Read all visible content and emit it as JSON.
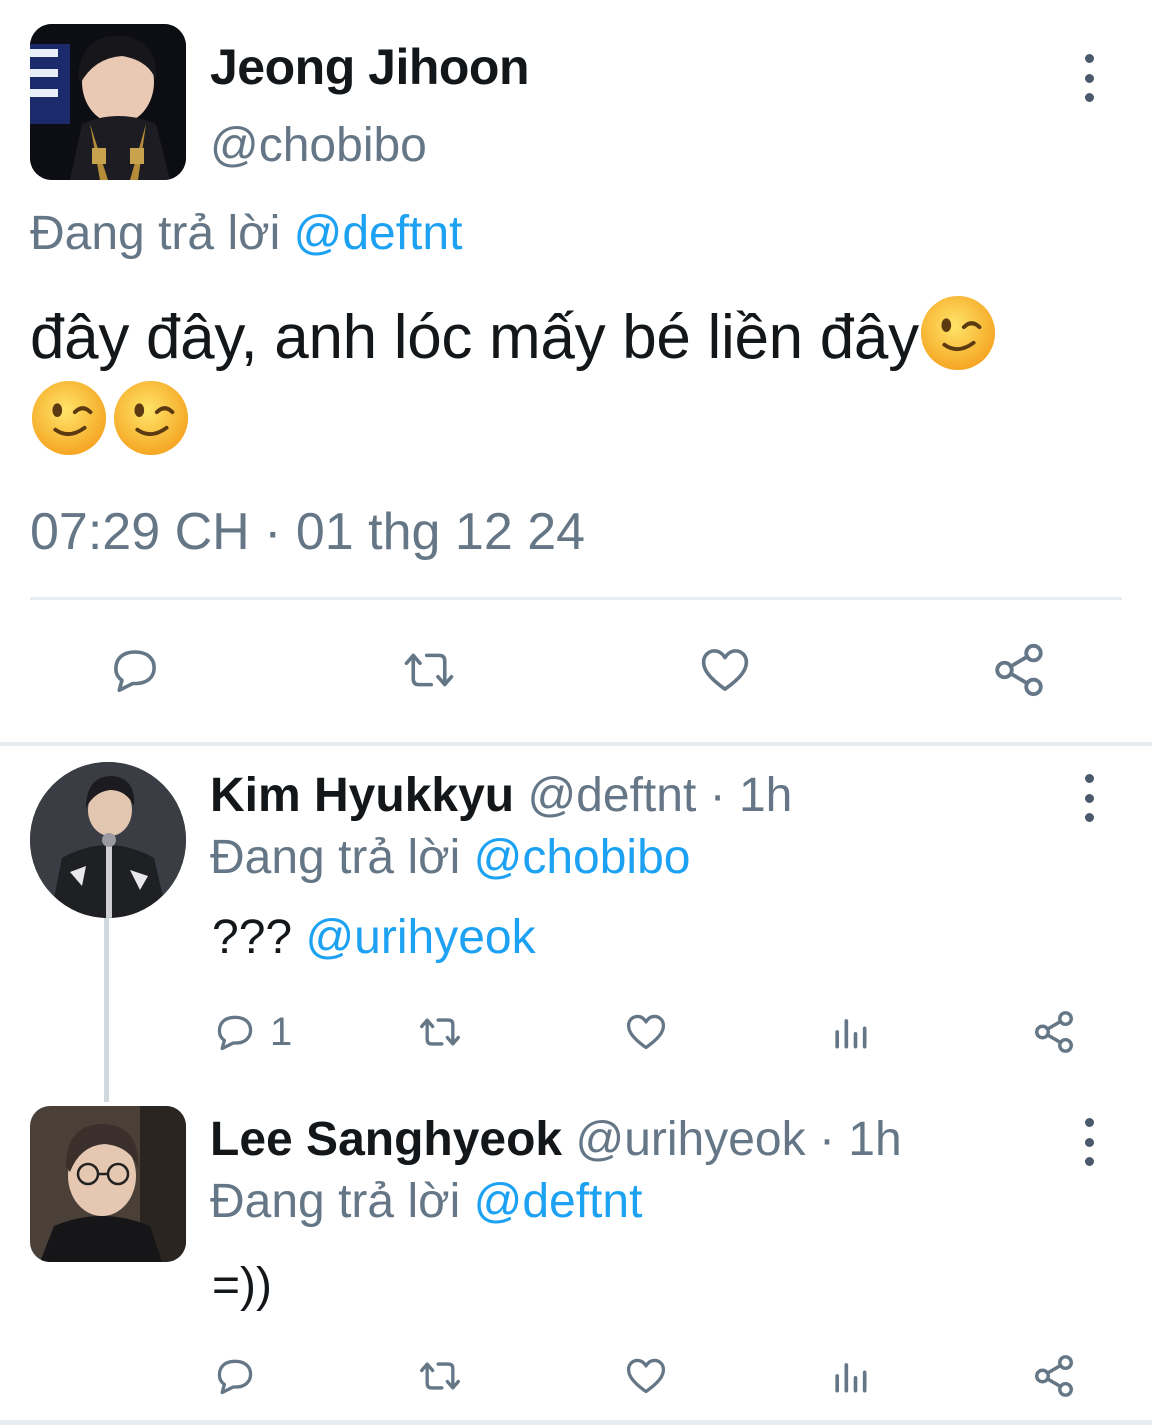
{
  "main_tweet": {
    "author_name": "Jeong Jihoon",
    "author_handle": "@chobibo",
    "reply_prefix": "Đang trả lời",
    "reply_to": "@deftnt",
    "text": "đây đây, anh lóc mấy bé liền đây",
    "emoji": [
      "winking-face",
      "winking-face",
      "winking-face"
    ],
    "timestamp": "07:29 CH · 01 thg 12 24",
    "actions": [
      "reply",
      "retweet",
      "like",
      "share"
    ]
  },
  "replies": [
    {
      "author_name": "Kim Hyukkyu",
      "author_handle": "@deftnt",
      "time_sep": " · ",
      "time": "1h",
      "reply_prefix": "Đang trả lời",
      "reply_to": "@chobibo",
      "text_prefix": "???",
      "mention": "@urihyeok",
      "reply_count": "1",
      "actions": [
        "reply",
        "retweet",
        "like",
        "analytics",
        "share"
      ]
    },
    {
      "author_name": "Lee Sanghyeok",
      "author_handle": "@urihyeok",
      "time_sep": " · ",
      "time": "1h",
      "reply_prefix": "Đang trả lời",
      "reply_to": "@deftnt",
      "text": "=))",
      "actions": [
        "reply",
        "retweet",
        "like",
        "analytics",
        "share"
      ]
    }
  ],
  "colors": {
    "accent": "#1da1f2",
    "secondary_text": "#657786",
    "primary_text": "#14171a",
    "divider": "#e6ecf0"
  }
}
